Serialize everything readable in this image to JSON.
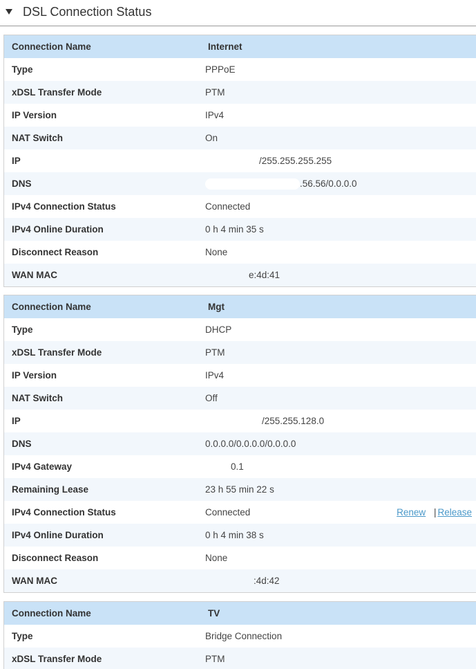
{
  "section": {
    "title": "DSL Connection Status"
  },
  "connections": [
    {
      "header": {
        "label": "Connection Name",
        "value": "Internet"
      },
      "rows": [
        {
          "label": "Type",
          "value": "PPPoE"
        },
        {
          "label": "xDSL Transfer Mode",
          "value": "PTM"
        },
        {
          "label": "IP Version",
          "value": "IPv4"
        },
        {
          "label": "NAT Switch",
          "value": "On"
        },
        {
          "label": "IP",
          "value": "/255.255.255.255"
        },
        {
          "label": "DNS",
          "value": ".56.56/0.0.0.0"
        },
        {
          "label": "IPv4 Connection Status",
          "value": "Connected"
        },
        {
          "label": "IPv4 Online Duration",
          "value": "0 h 4 min 35 s"
        },
        {
          "label": "Disconnect Reason",
          "value": "None"
        },
        {
          "label": "WAN MAC",
          "value": "e:4d:41"
        }
      ]
    },
    {
      "header": {
        "label": "Connection Name",
        "value": "Mgt"
      },
      "rows": [
        {
          "label": "Type",
          "value": "DHCP"
        },
        {
          "label": "xDSL Transfer Mode",
          "value": "PTM"
        },
        {
          "label": "IP Version",
          "value": "IPv4"
        },
        {
          "label": "NAT Switch",
          "value": "Off"
        },
        {
          "label": "IP",
          "value": "/255.255.128.0"
        },
        {
          "label": "DNS",
          "value": "0.0.0.0/0.0.0.0/0.0.0.0"
        },
        {
          "label": "IPv4 Gateway",
          "value": "0.1"
        },
        {
          "label": "Remaining Lease",
          "value": "23 h 55 min 22 s"
        },
        {
          "label": "IPv4 Connection Status",
          "value": "Connected"
        },
        {
          "label": "IPv4 Online Duration",
          "value": "0 h 4 min 38 s"
        },
        {
          "label": "Disconnect Reason",
          "value": "None"
        },
        {
          "label": "WAN MAC",
          "value": ":4d:42"
        }
      ],
      "actions": {
        "renew": "Renew",
        "separator": "|",
        "release": "Release"
      }
    },
    {
      "header": {
        "label": "Connection Name",
        "value": "TV"
      },
      "rows": [
        {
          "label": "Type",
          "value": "Bridge Connection"
        },
        {
          "label": "xDSL Transfer Mode",
          "value": "PTM"
        }
      ]
    }
  ]
}
